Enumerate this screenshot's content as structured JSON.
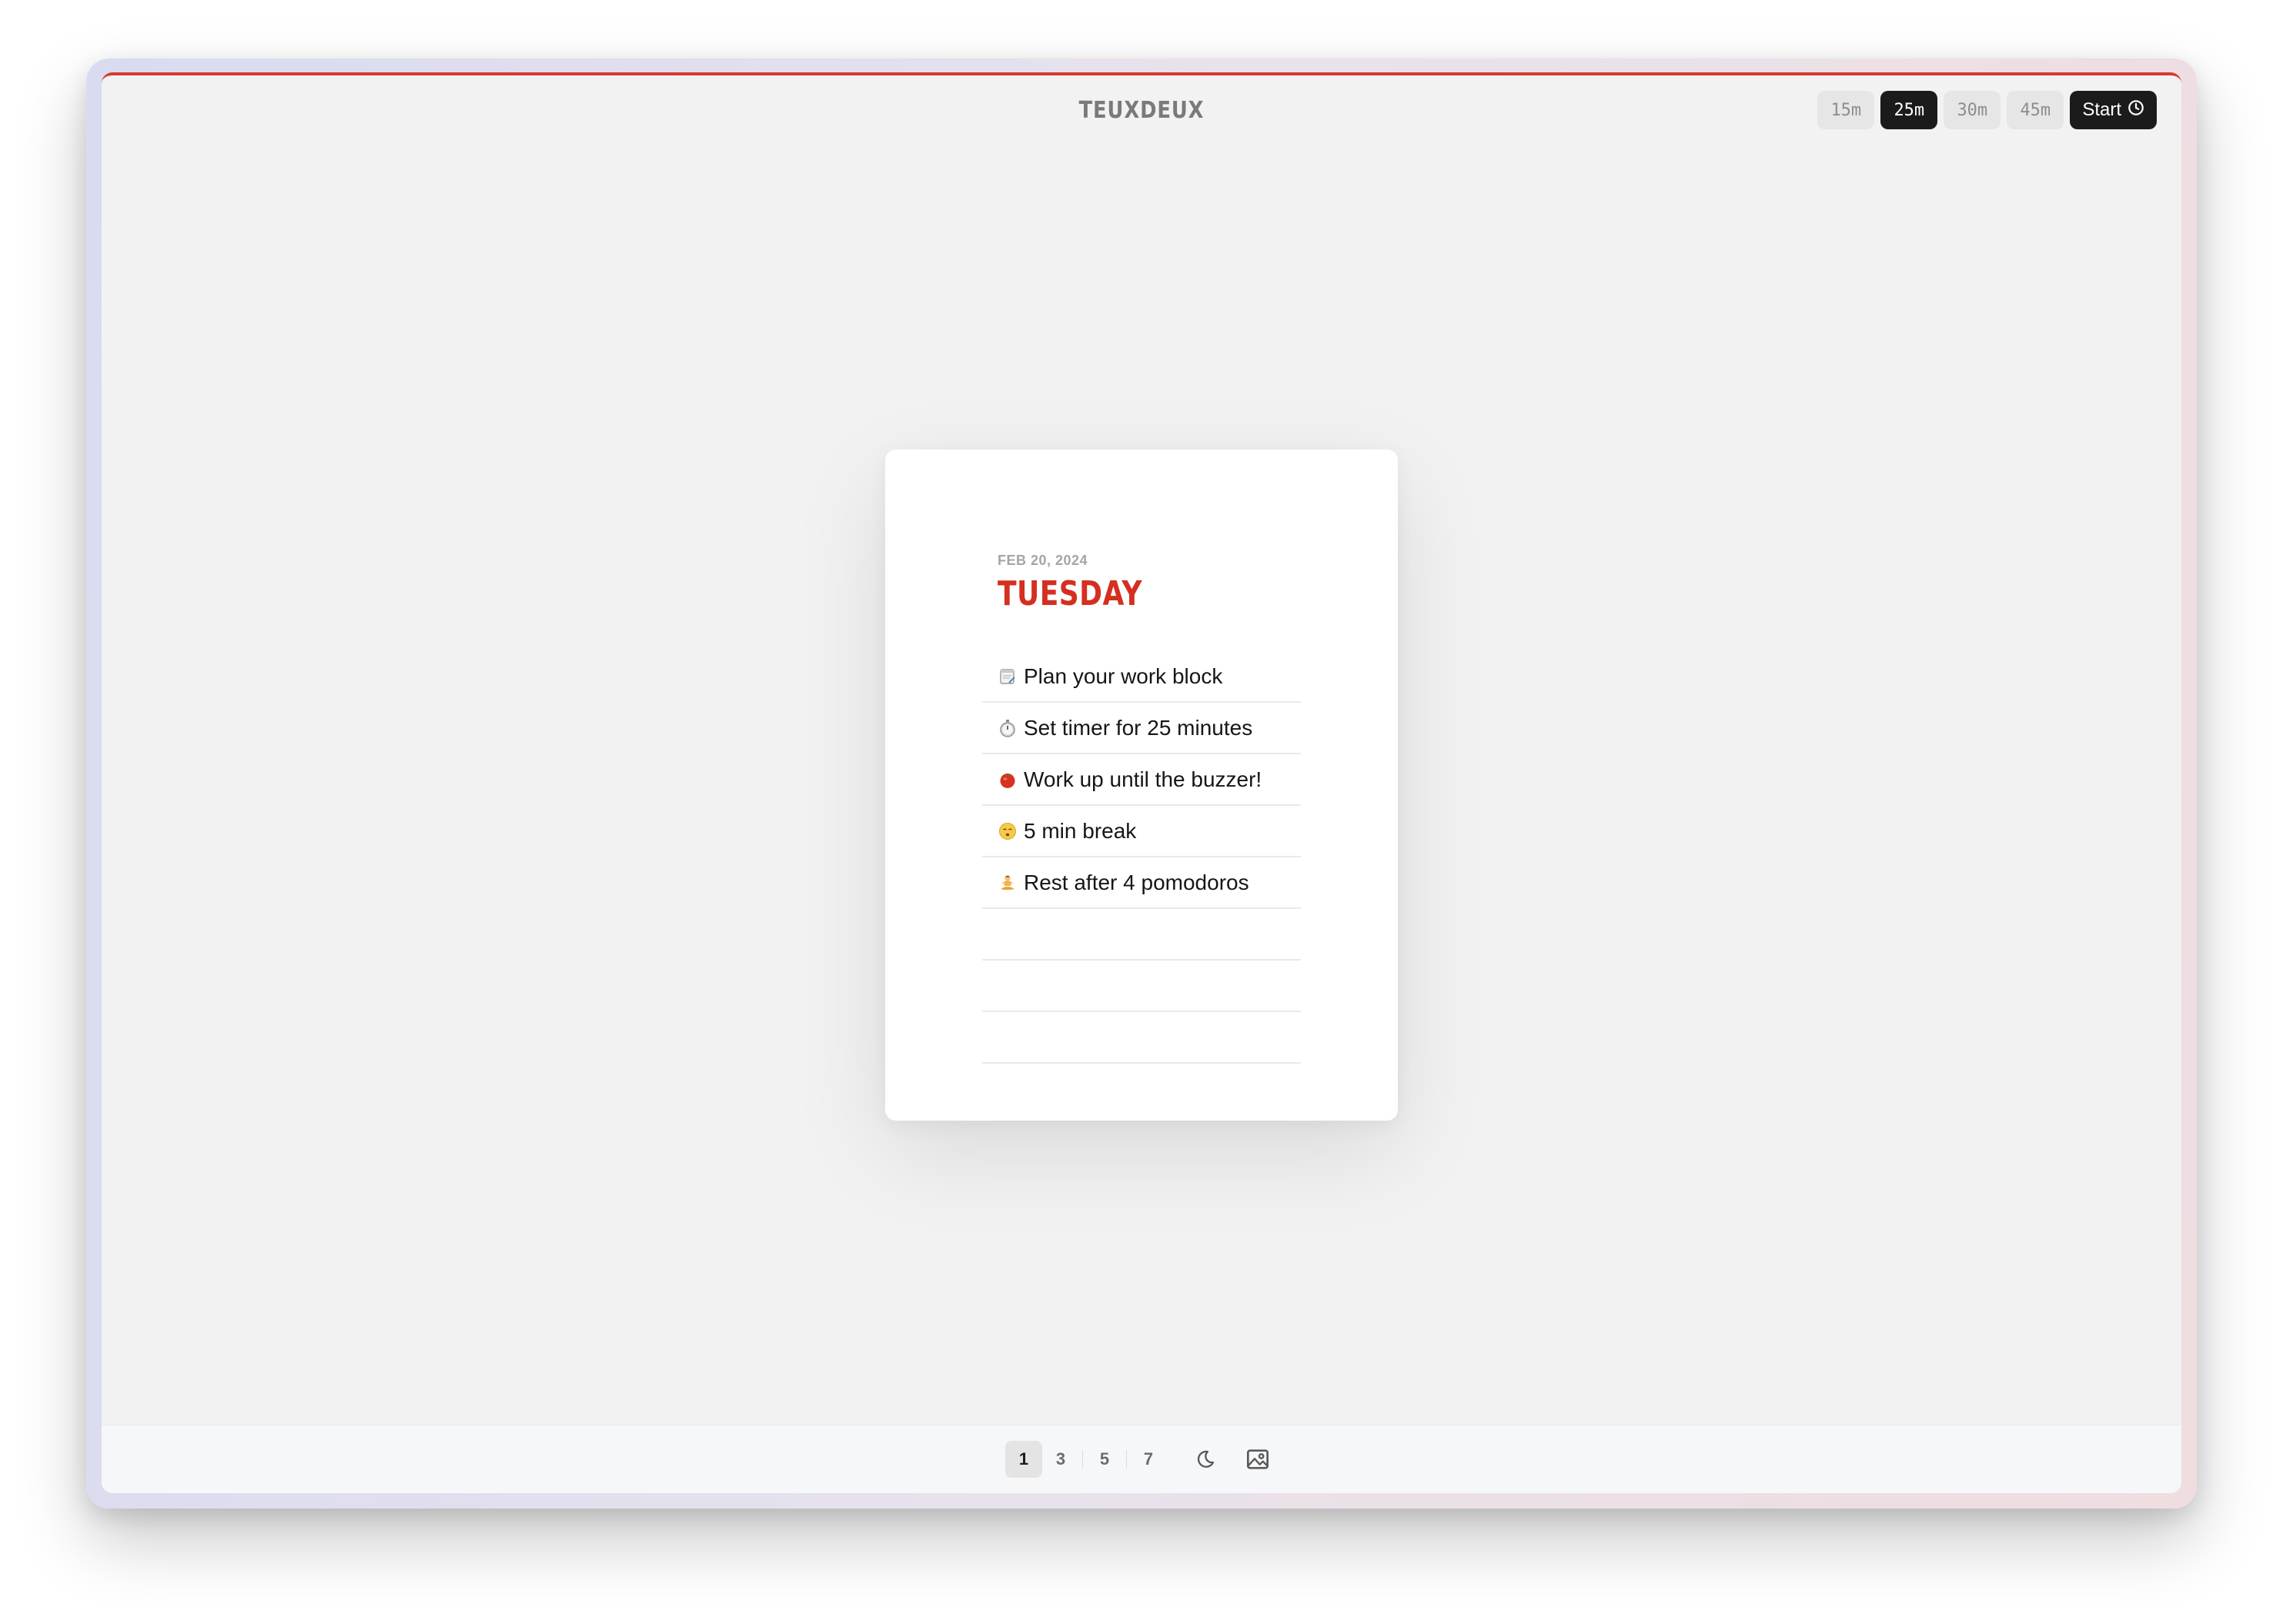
{
  "app": {
    "title": "TEUXDEUX",
    "accent_color": "#d42f20"
  },
  "timer": {
    "options": [
      "15m",
      "25m",
      "30m",
      "45m"
    ],
    "selected": "25m",
    "start_label": "Start",
    "start_icon": "clock-icon"
  },
  "day_card": {
    "date": "FEB 20, 2024",
    "weekday": "TUESDAY",
    "tasks": [
      {
        "emoji": "notepad-icon",
        "text": "Plan your work block"
      },
      {
        "emoji": "stopwatch-icon",
        "text": "Set timer for 25 minutes"
      },
      {
        "emoji": "tomato-icon",
        "text": "Work up until the buzzer!"
      },
      {
        "emoji": "relieved-face-icon",
        "text": "5 min break"
      },
      {
        "emoji": "person-in-lotus-icon",
        "text": "Rest after 4 pomodoros"
      }
    ],
    "empty_rows": 3
  },
  "bottom_bar": {
    "columns": [
      "1",
      "3",
      "5",
      "7"
    ],
    "selected_columns": "1",
    "icons": [
      "dark-mode-icon",
      "background-image-icon"
    ]
  }
}
